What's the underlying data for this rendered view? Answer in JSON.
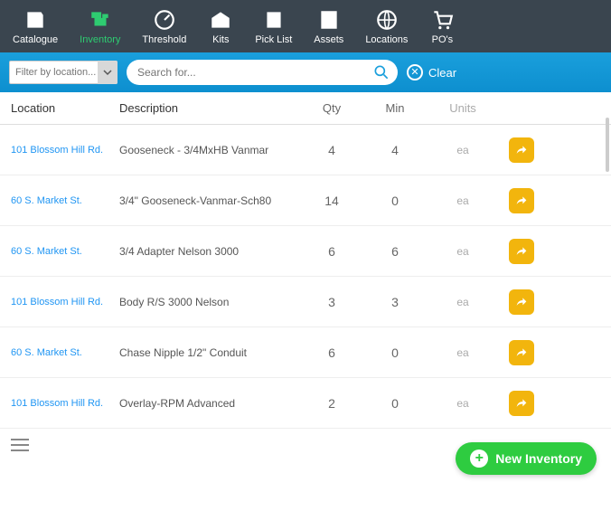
{
  "nav": {
    "catalogue": "Catalogue",
    "inventory": "Inventory",
    "threshold": "Threshold",
    "kits": "Kits",
    "picklist": "Pick List",
    "assets": "Assets",
    "locations": "Locations",
    "pos": "PO's"
  },
  "filter": {
    "location_placeholder": "Filter by location...",
    "search_placeholder": "Search for...",
    "clear_label": "Clear"
  },
  "columns": {
    "location": "Location",
    "description": "Description",
    "qty": "Qty",
    "min": "Min",
    "units": "Units"
  },
  "rows": [
    {
      "location": "101 Blossom Hill Rd.",
      "description": "Gooseneck - 3/4MxHB Vanmar",
      "qty": "4",
      "min": "4",
      "units": "ea"
    },
    {
      "location": "60 S. Market St.",
      "description": "3/4\" Gooseneck-Vanmar-Sch80",
      "qty": "14",
      "min": "0",
      "units": "ea"
    },
    {
      "location": "60 S. Market St.",
      "description": "3/4 Adapter Nelson 3000",
      "qty": "6",
      "min": "6",
      "units": "ea"
    },
    {
      "location": "101 Blossom Hill Rd.",
      "description": "Body R/S 3000 Nelson",
      "qty": "3",
      "min": "3",
      "units": "ea"
    },
    {
      "location": "60 S. Market St.",
      "description": "Chase Nipple 1/2\" Conduit",
      "qty": "6",
      "min": "0",
      "units": "ea"
    },
    {
      "location": "101 Blossom Hill Rd.",
      "description": "Overlay-RPM Advanced",
      "qty": "2",
      "min": "0",
      "units": "ea"
    }
  ],
  "fab_label": "New Inventory"
}
